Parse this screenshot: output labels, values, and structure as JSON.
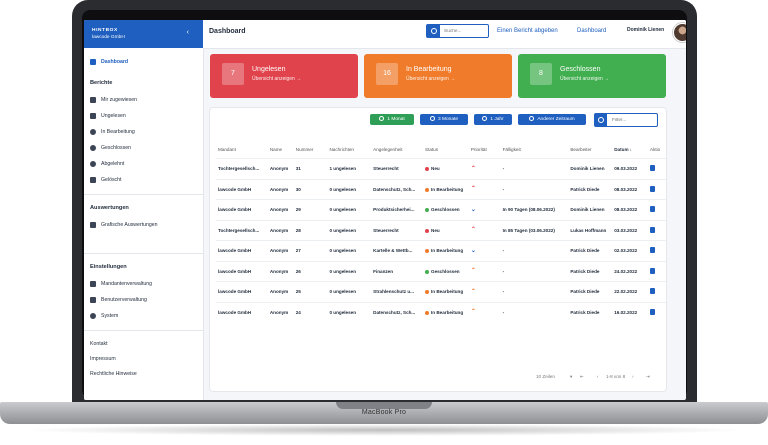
{
  "sidebar": {
    "brand_title": "HINTBOX",
    "brand_sub": "lawcode GmbH",
    "collapse_icon": "chevron-left-icon",
    "dashboard": "Dashboard",
    "berichte_head": "Berichte",
    "berichte": [
      "Mir zugewiesen",
      "Ungelesen",
      "In Bearbeitung",
      "Geschlossen",
      "Abgelehnt",
      "Gelöscht"
    ],
    "auswertungen_head": "Auswertungen",
    "auswertungen": [
      "Grafische Auswertungen"
    ],
    "einstellungen_head": "Einstellungen",
    "einstellungen": [
      "Mandantenverwaltung",
      "Benutzerverwaltung",
      "System"
    ],
    "footer_links": [
      "Kontakt",
      "Impressum",
      "Rechtliche Hinweise"
    ]
  },
  "topbar": {
    "title": "Dashboard",
    "search_placeholder": "Suche...",
    "link_report": "Einen Bericht abgeben",
    "link_dashboard": "Dashboard",
    "user": "Dominik Lienen"
  },
  "cards": [
    {
      "count": "7",
      "label": "Ungelesen",
      "sub": "Übersicht anzeigen →",
      "color": "#e0434c"
    },
    {
      "count": "16",
      "label": "In Bearbeitung",
      "sub": "Übersicht anzeigen →",
      "color": "#f07b2a"
    },
    {
      "count": "8",
      "label": "Geschlossen",
      "sub": "Übersicht anzeigen →",
      "color": "#41ae4f"
    }
  ],
  "filters": {
    "range_buttons": [
      "1 Monat",
      "3 Monate",
      "1 Jahr",
      "Anderer Zeitraum"
    ],
    "active": "1 Monat",
    "filter_placeholder": "Filter..."
  },
  "table": {
    "headers": [
      "Mandant",
      "Name",
      "Nummer",
      "Nachrichten",
      "Angelegenheit",
      "Status",
      "Priorität",
      "Fälligkeit",
      "Bearbeiter",
      "Datum ↓",
      "Aktio"
    ],
    "sorted_column": "Datum ↓",
    "rows": [
      {
        "mandant": "Tochtergesellsch...",
        "name": "Anonym",
        "nummer": "31",
        "nachrichten": "1 ungelesen",
        "angelegenheit": "Steuerrecht",
        "status": "Neu",
        "status_color": "#e0434c",
        "prio": "high",
        "faellig": "-",
        "bearbeiter": "Dominik Lienen",
        "datum": "09.03.2022"
      },
      {
        "mandant": "lawcode GmbH",
        "name": "Anonym",
        "nummer": "30",
        "nachrichten": "0 ungelesen",
        "angelegenheit": "Datenschutz, Sch...",
        "status": "In Bearbeitung",
        "status_color": "#f07b2a",
        "prio": "high",
        "faellig": "-",
        "bearbeiter": "Patrick Diede",
        "datum": "08.03.2022"
      },
      {
        "mandant": "lawcode GmbH",
        "name": "Anonym",
        "nummer": "29",
        "nachrichten": "0 ungelesen",
        "angelegenheit": "Produktsicherhei...",
        "status": "Geschlossen",
        "status_color": "#41ae4f",
        "prio": "low",
        "faellig": "In 90 Tagen (08.06.2022)",
        "bearbeiter": "Dominik Lienen",
        "datum": "08.03.2022"
      },
      {
        "mandant": "Tochtergesellsch...",
        "name": "Anonym",
        "nummer": "28",
        "nachrichten": "0 ungelesen",
        "angelegenheit": "Steuerrecht",
        "status": "Neu",
        "status_color": "#e0434c",
        "prio": "high",
        "faellig": "In 85 Tagen (03.06.2022)",
        "bearbeiter": "Lukas Hoffmann",
        "datum": "03.03.2022"
      },
      {
        "mandant": "lawcode GmbH",
        "name": "Anonym",
        "nummer": "27",
        "nachrichten": "0 ungelesen",
        "angelegenheit": "Kartelle & Wettb...",
        "status": "In Bearbeitung",
        "status_color": "#f07b2a",
        "prio": "low",
        "faellig": "-",
        "bearbeiter": "Patrick Diede",
        "datum": "02.03.2022"
      },
      {
        "mandant": "lawcode GmbH",
        "name": "Anonym",
        "nummer": "26",
        "nachrichten": "0 ungelesen",
        "angelegenheit": "Finanzen",
        "status": "Geschlossen",
        "status_color": "#41ae4f",
        "prio": "mid",
        "faellig": "-",
        "bearbeiter": "Patrick Diede",
        "datum": "24.02.2022"
      },
      {
        "mandant": "lawcode GmbH",
        "name": "Anonym",
        "nummer": "25",
        "nachrichten": "0 ungelesen",
        "angelegenheit": "Strahlenschutz u...",
        "status": "In Bearbeitung",
        "status_color": "#f07b2a",
        "prio": "mid",
        "faellig": "-",
        "bearbeiter": "Patrick Diede",
        "datum": "22.02.2022"
      },
      {
        "mandant": "lawcode GmbH",
        "name": "Anonym",
        "nummer": "24",
        "nachrichten": "0 ungelesen",
        "angelegenheit": "Datenschutz, Sch...",
        "status": "In Bearbeitung",
        "status_color": "#f07b2a",
        "prio": "mid",
        "faellig": "-",
        "bearbeiter": "Patrick Diede",
        "datum": "16.02.2022"
      }
    ]
  },
  "pager": {
    "rows_label": "10 Zeilen",
    "range": "1-8 von 8"
  },
  "device": {
    "label": "MacBook Pro"
  }
}
